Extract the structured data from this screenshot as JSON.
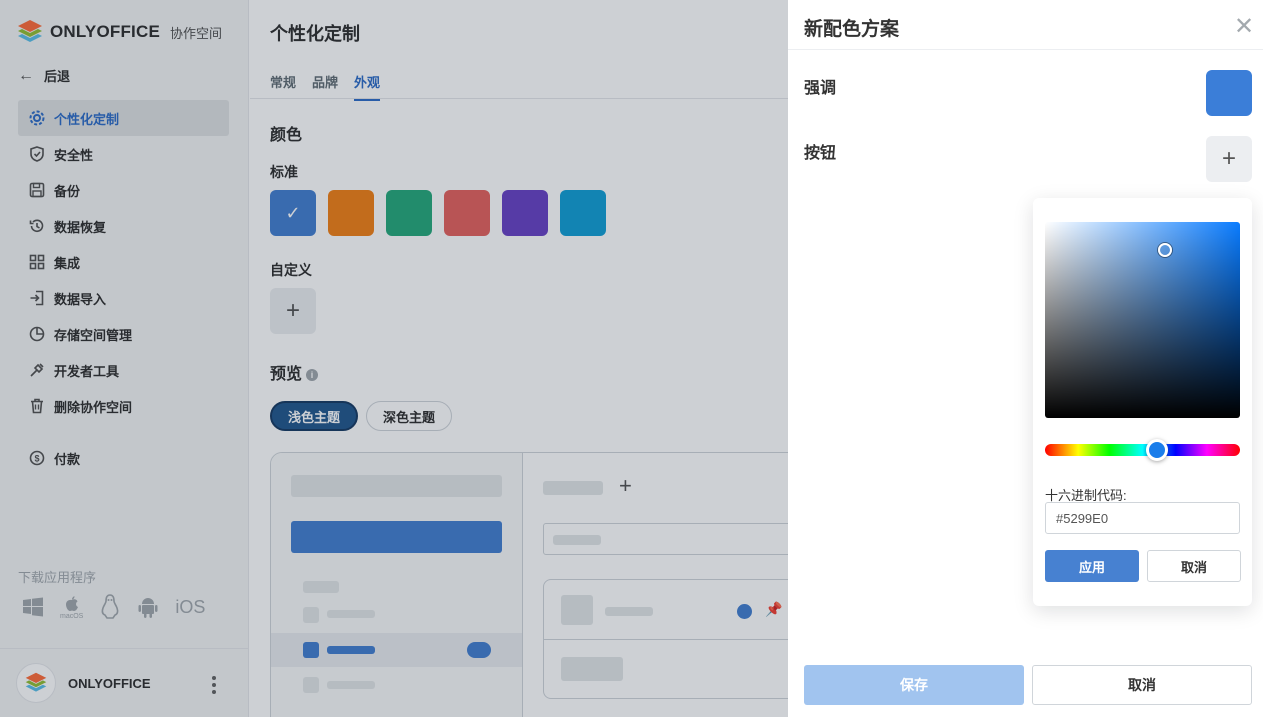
{
  "sidebar": {
    "brand": "ONLYOFFICE",
    "brand_sub": "协作空间",
    "back_label": "后退",
    "items": [
      {
        "label": "个性化定制",
        "icon": "gear-icon",
        "active": true
      },
      {
        "label": "安全性",
        "icon": "shield-icon"
      },
      {
        "label": "备份",
        "icon": "save-icon"
      },
      {
        "label": "数据恢复",
        "icon": "history-icon"
      },
      {
        "label": "集成",
        "icon": "grid-icon"
      },
      {
        "label": "数据导入",
        "icon": "import-icon"
      },
      {
        "label": "存储空间管理",
        "icon": "pie-chart-icon"
      },
      {
        "label": "开发者工具",
        "icon": "tools-icon"
      },
      {
        "label": "删除协作空间",
        "icon": "trash-icon"
      }
    ],
    "payment_label": "付款",
    "download_title": "下载应用程序",
    "apps": {
      "macos": "macOS",
      "ios": "iOS"
    },
    "user_name": "ONLYOFFICE"
  },
  "main": {
    "title": "个性化定制",
    "tabs": [
      "常规",
      "品牌",
      "外观"
    ],
    "active_tab": 2,
    "color_heading": "颜色",
    "standard_label": "标准",
    "standard_colors": [
      "#4781d1",
      "#f2821a",
      "#2aaa7e",
      "#e56561",
      "#6b45c6",
      "#16a1d6"
    ],
    "custom_label": "自定义",
    "add_symbol": "+",
    "preview_label": "预览",
    "theme_light": "浅色主题",
    "theme_dark": "深色主题"
  },
  "panel": {
    "title": "新配色方案",
    "accent_label": "强调",
    "accent_color": "#3b7ed8",
    "button_label": "按钮",
    "add_symbol": "+",
    "picker": {
      "hex_label": "十六进制代码:",
      "hex_value": "#5299E0",
      "apply_label": "应用",
      "cancel_label": "取消"
    },
    "save_label": "保存",
    "cancel_label": "取消"
  }
}
